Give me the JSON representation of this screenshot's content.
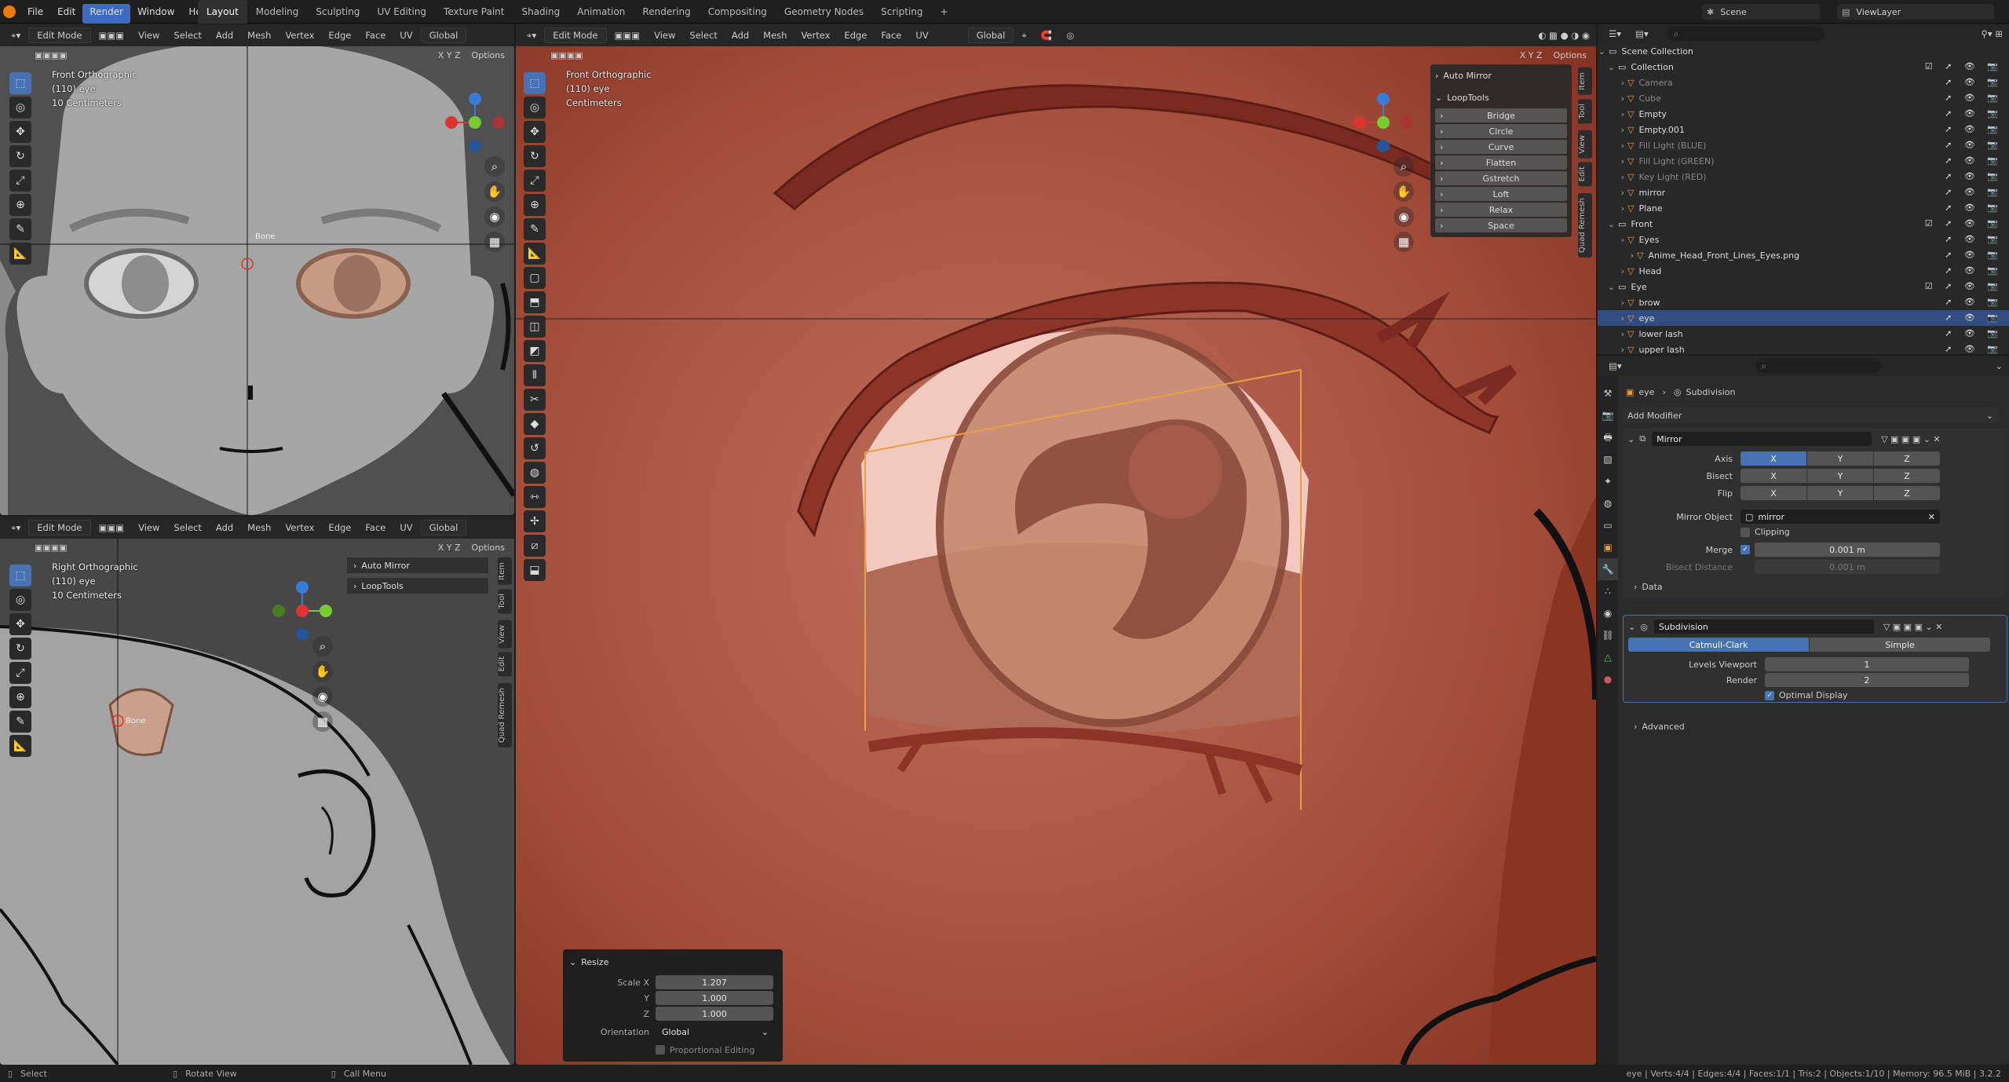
{
  "topbar": {
    "menus": [
      "File",
      "Edit",
      "Render",
      "Window",
      "Help"
    ],
    "active_menu": "Render",
    "workspaces": [
      "Layout",
      "Modeling",
      "Sculpting",
      "UV Editing",
      "Texture Paint",
      "Shading",
      "Animation",
      "Rendering",
      "Compositing",
      "Geometry Nodes",
      "Scripting"
    ],
    "active_workspace": "Layout",
    "add_tab": "+",
    "scene": "Scene",
    "view_layer": "ViewLayer"
  },
  "header": {
    "mode": "Edit Mode",
    "menus": [
      "View",
      "Select",
      "Add",
      "Mesh",
      "Vertex",
      "Edge",
      "Face",
      "UV"
    ],
    "orientation": "Global",
    "options": "Options",
    "axes": [
      "X",
      "Y",
      "Z"
    ]
  },
  "viewport_tl": {
    "view": "Front Orthographic",
    "object": "(110) eye",
    "scale": "10 Centimeters",
    "cursor_label": "Bone"
  },
  "viewport_bl": {
    "view": "Right Orthographic",
    "object": "(110) eye",
    "scale": "10 Centimeters",
    "cursor_label": "Bone",
    "panels": [
      "Auto Mirror",
      "LoopTools"
    ]
  },
  "viewport_main": {
    "view": "Front Orthographic",
    "object": "(110) eye",
    "scale": "Centimeters",
    "panels": [
      "Auto Mirror",
      "LoopTools"
    ],
    "looptools": [
      "Bridge",
      "Circle",
      "Curve",
      "Flatten",
      "Gstretch",
      "Loft",
      "Relax",
      "Space"
    ]
  },
  "side_tabs": [
    "Item",
    "Tool",
    "View",
    "Edit",
    "Quad Remesh"
  ],
  "resize_panel": {
    "title": "Resize",
    "scale_x_label": "Scale X",
    "scale_x": "1.207",
    "y_label": "Y",
    "y": "1.000",
    "z_label": "Z",
    "z": "1.000",
    "orientation_label": "Orientation",
    "orientation": "Global",
    "proportional": "Proportional Editing"
  },
  "outliner": {
    "search_placeholder": "",
    "rows": [
      {
        "label": "Scene Collection",
        "indent": 0,
        "kind": "scene"
      },
      {
        "label": "Collection",
        "indent": 1,
        "kind": "collection"
      },
      {
        "label": "Camera",
        "indent": 2,
        "kind": "dim"
      },
      {
        "label": "Cube",
        "indent": 2,
        "kind": "dim"
      },
      {
        "label": "Empty",
        "indent": 2,
        "kind": "obj"
      },
      {
        "label": "Empty.001",
        "indent": 2,
        "kind": "obj"
      },
      {
        "label": "Fill Light (BLUE)",
        "indent": 2,
        "kind": "dim"
      },
      {
        "label": "Fill Light (GREEN)",
        "indent": 2,
        "kind": "dim"
      },
      {
        "label": "Key Light (RED)",
        "indent": 2,
        "kind": "dim"
      },
      {
        "label": "mirror",
        "indent": 2,
        "kind": "obj"
      },
      {
        "label": "Plane",
        "indent": 2,
        "kind": "obj"
      },
      {
        "label": "Front",
        "indent": 1,
        "kind": "collection"
      },
      {
        "label": "Eyes",
        "indent": 2,
        "kind": "obj"
      },
      {
        "label": "Anime_Head_Front_Lines_Eyes.png",
        "indent": 3,
        "kind": "obj"
      },
      {
        "label": "Head",
        "indent": 2,
        "kind": "obj"
      },
      {
        "label": "Eye",
        "indent": 1,
        "kind": "collection"
      },
      {
        "label": "brow",
        "indent": 2,
        "kind": "obj"
      },
      {
        "label": "eye",
        "indent": 2,
        "kind": "selected"
      },
      {
        "label": "lower lash",
        "indent": 2,
        "kind": "obj"
      },
      {
        "label": "upper lash",
        "indent": 2,
        "kind": "obj"
      }
    ]
  },
  "properties": {
    "breadcrumb_obj": "eye",
    "breadcrumb_mod": "Subdivision",
    "add_modifier": "Add Modifier",
    "mirror": {
      "name": "Mirror",
      "axis_label": "Axis",
      "bisect_label": "Bisect",
      "flip_label": "Flip",
      "axes": [
        "X",
        "Y",
        "Z"
      ],
      "mirror_object_label": "Mirror Object",
      "mirror_object": "mirror",
      "clipping": "Clipping",
      "merge_label": "Merge",
      "merge": "0.001 m",
      "bisect_distance_label": "Bisect Distance",
      "bisect_distance": "0.001 m",
      "data": "Data"
    },
    "subdivision": {
      "name": "Subdivision",
      "catmull": "Catmull-Clark",
      "simple": "Simple",
      "levels_label": "Levels Viewport",
      "levels": "1",
      "render_label": "Render",
      "render": "2",
      "optimal": "Optimal Display",
      "advanced": "Advanced"
    }
  },
  "statusbar": {
    "select": "Select",
    "rotate": "Rotate View",
    "call_menu": "Call Menu",
    "stats": "eye | Verts:4/4 | Edges:4/4 | Faces:1/1 | Tris:2 | Objects:1/10 | Memory: 96.5 MiB | 3.2.2"
  }
}
